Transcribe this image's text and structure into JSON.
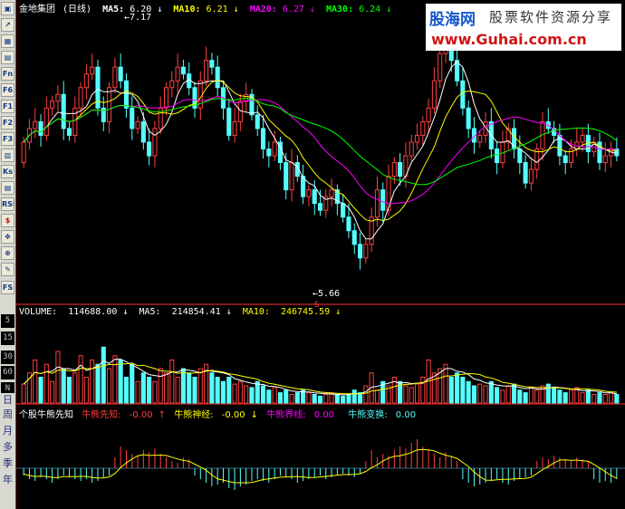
{
  "toolbar": {
    "icon_buttons": [
      "window-icon",
      "line-chart-icon",
      "grid-icon",
      "table-icon",
      "fund-icon",
      "fund-icon",
      "fund-icon",
      "fund-icon",
      "fund-icon",
      "candlestick-icon",
      "ks-icon",
      "dmi-icon",
      "rsi-icon",
      "dollar-icon",
      "move-icon",
      "zoom-icon",
      "pencil-icon",
      "fs-icon"
    ],
    "labels_top": [
      "Fn",
      "F6",
      "F1",
      "F2",
      "F3",
      "F4",
      "Ks",
      "RSI",
      "$",
      "FS"
    ],
    "volume_scale": [
      "5",
      "15",
      "30",
      "60",
      "N"
    ],
    "period_buttons": [
      "日",
      "周",
      "月",
      "多",
      "季",
      "年"
    ]
  },
  "main": {
    "stock_name": "金地集团",
    "period": "(日线)",
    "ma5_label": "MA5:",
    "ma5_value": "6.20",
    "ma10_label": "MA10:",
    "ma10_value": "6.21",
    "ma20_label": "MA20:",
    "ma20_value": "6.27",
    "ma30_label": "MA30:",
    "ma30_value": "6.24",
    "high_marker": "7.17",
    "low_marker": "5.66",
    "low_flag": "S"
  },
  "volume": {
    "label": "VOLUME:",
    "value": "114688.00",
    "ma5_label": "MA5:",
    "ma5_value": "214854.41",
    "ma10_label": "MA10:",
    "ma10_value": "246745.59"
  },
  "indicator": {
    "name": "个股牛熊先知",
    "l1_label": "牛熊先知:",
    "l1_value": "-0.00",
    "l2_label": "牛熊神经:",
    "l2_value": "-0.00",
    "l3_label": "牛熊界线:",
    "l3_value": "0.00",
    "l4_label": "牛熊变换:",
    "l4_value": "0.00"
  },
  "watermark": {
    "brand": "股海网",
    "slogan": "股票软件资源分享",
    "url": "www.Guhai.com.cn"
  },
  "colors": {
    "up": "#ff4040",
    "down": "#54ffff",
    "ma5": "#ffffff",
    "ma10": "#ffff00",
    "ma20": "#ff00ff",
    "ma30": "#00ff00",
    "border": "#b02020"
  },
  "chart_data": [
    {
      "type": "candlestick",
      "title": "金地集团 (日线)",
      "ylim": [
        5.3,
        7.4
      ],
      "open": [
        6.3,
        6.45,
        6.55,
        6.6,
        6.5,
        6.7,
        6.75,
        6.8,
        6.55,
        6.5,
        6.7,
        6.85,
        6.95,
        7.0,
        6.7,
        6.6,
        6.85,
        7.0,
        6.9,
        6.7,
        6.55,
        6.6,
        6.45,
        6.35,
        6.55,
        6.7,
        6.85,
        6.9,
        7.0,
        6.95,
        6.85,
        6.7,
        6.9,
        7.05,
        7.0,
        6.85,
        6.7,
        6.5,
        6.6,
        6.75,
        6.8,
        6.65,
        6.55,
        6.4,
        6.35,
        6.45,
        6.3,
        6.1,
        6.3,
        6.2,
        6.05,
        6.1,
        6.0,
        5.95,
        6.05,
        6.1,
        6.0,
        5.9,
        5.8,
        5.7,
        5.6,
        5.7,
        5.9,
        6.1,
        5.95,
        6.2,
        6.3,
        6.2,
        6.35,
        6.45,
        6.5,
        6.6,
        6.7,
        6.9,
        7.1,
        7.25,
        7.05,
        6.9,
        6.7,
        6.55,
        6.45,
        6.5,
        6.6,
        6.4,
        6.3,
        6.45,
        6.55,
        6.4,
        6.3,
        6.15,
        6.25,
        6.4,
        6.6,
        6.55,
        6.5,
        6.35,
        6.3,
        6.4,
        6.45,
        6.5,
        6.38,
        6.45,
        6.3,
        6.35,
        6.4
      ],
      "close": [
        6.45,
        6.55,
        6.6,
        6.5,
        6.7,
        6.75,
        6.8,
        6.55,
        6.5,
        6.7,
        6.85,
        6.95,
        7.0,
        6.7,
        6.6,
        6.85,
        7.0,
        6.9,
        6.7,
        6.55,
        6.6,
        6.45,
        6.35,
        6.55,
        6.7,
        6.85,
        6.9,
        7.0,
        6.95,
        6.85,
        6.7,
        6.9,
        7.05,
        7.0,
        6.85,
        6.7,
        6.5,
        6.6,
        6.75,
        6.8,
        6.65,
        6.55,
        6.4,
        6.35,
        6.45,
        6.3,
        6.1,
        6.3,
        6.2,
        6.05,
        6.1,
        6.0,
        5.95,
        6.05,
        6.1,
        6.0,
        5.9,
        5.8,
        5.7,
        5.6,
        5.7,
        5.9,
        6.1,
        5.95,
        6.2,
        6.3,
        6.2,
        6.35,
        6.45,
        6.5,
        6.6,
        6.7,
        6.9,
        7.1,
        7.25,
        7.05,
        6.9,
        6.7,
        6.55,
        6.45,
        6.5,
        6.6,
        6.4,
        6.3,
        6.45,
        6.55,
        6.4,
        6.3,
        6.15,
        6.25,
        6.4,
        6.6,
        6.55,
        6.5,
        6.35,
        6.3,
        6.4,
        6.45,
        6.5,
        6.38,
        6.45,
        6.3,
        6.35,
        6.4,
        6.35
      ],
      "series_names": [
        "MA5",
        "MA10",
        "MA20",
        "MA30"
      ]
    },
    {
      "type": "bar",
      "title": "VOLUME",
      "ylim": [
        0,
        1
      ],
      "values": [
        0.22,
        0.35,
        0.5,
        0.3,
        0.45,
        0.25,
        0.6,
        0.4,
        0.3,
        0.35,
        0.55,
        0.3,
        0.5,
        0.45,
        0.65,
        0.4,
        0.55,
        0.5,
        0.3,
        0.45,
        0.25,
        0.35,
        0.3,
        0.25,
        0.4,
        0.35,
        0.5,
        0.3,
        0.4,
        0.35,
        0.3,
        0.4,
        0.45,
        0.35,
        0.3,
        0.25,
        0.3,
        0.22,
        0.25,
        0.2,
        0.18,
        0.25,
        0.2,
        0.15,
        0.18,
        0.12,
        0.15,
        0.1,
        0.12,
        0.15,
        0.12,
        0.1,
        0.08,
        0.1,
        0.12,
        0.1,
        0.08,
        0.1,
        0.15,
        0.12,
        0.2,
        0.35,
        0.15,
        0.25,
        0.2,
        0.3,
        0.25,
        0.2,
        0.18,
        0.22,
        0.3,
        0.5,
        0.35,
        0.4,
        0.45,
        0.3,
        0.35,
        0.3,
        0.25,
        0.2,
        0.22,
        0.2,
        0.25,
        0.18,
        0.15,
        0.2,
        0.22,
        0.15,
        0.12,
        0.18,
        0.15,
        0.2,
        0.22,
        0.18,
        0.15,
        0.12,
        0.15,
        0.18,
        0.12,
        0.15,
        0.1,
        0.12,
        0.1,
        0.12,
        0.1
      ]
    },
    {
      "type": "bar",
      "title": "个股牛熊先知",
      "ylim": [
        -1,
        1
      ],
      "values": [
        -0.2,
        -0.3,
        -0.35,
        -0.25,
        -0.3,
        -0.4,
        -0.3,
        -0.2,
        -0.25,
        -0.3,
        -0.35,
        -0.3,
        -0.4,
        -0.35,
        -0.25,
        -0.2,
        0.3,
        0.6,
        0.5,
        0.4,
        0.35,
        0.5,
        0.45,
        0.55,
        0.4,
        0.3,
        0.2,
        0.15,
        0.3,
        0.25,
        -0.2,
        -0.3,
        -0.4,
        -0.5,
        -0.45,
        -0.4,
        -0.55,
        -0.6,
        -0.5,
        -0.45,
        -0.35,
        -0.3,
        -0.35,
        -0.4,
        -0.3,
        -0.2,
        -0.25,
        -0.3,
        -0.4,
        -0.35,
        -0.3,
        -0.25,
        -0.2,
        -0.3,
        -0.25,
        -0.2,
        -0.15,
        -0.2,
        -0.25,
        -0.15,
        0.2,
        0.5,
        0.3,
        0.4,
        0.35,
        0.5,
        0.6,
        0.55,
        0.7,
        0.8,
        0.6,
        0.5,
        0.4,
        0.3,
        0.45,
        0.35,
        0.2,
        -0.3,
        -0.4,
        -0.5,
        -0.45,
        -0.4,
        -0.35,
        -0.3,
        -0.4,
        -0.45,
        -0.35,
        -0.3,
        -0.25,
        -0.2,
        0.2,
        0.3,
        0.25,
        0.35,
        0.3,
        0.25,
        0.2,
        0.3,
        0.25,
        0.2,
        -0.3,
        -0.4,
        -0.35,
        -0.4,
        -0.3
      ]
    }
  ]
}
